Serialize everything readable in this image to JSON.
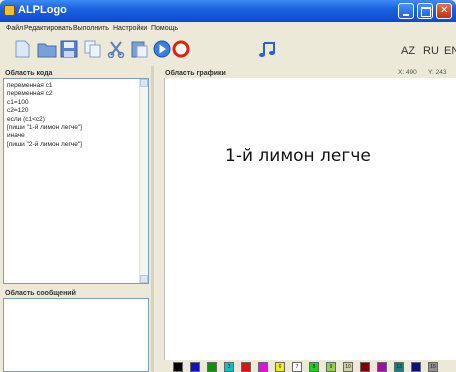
{
  "window": {
    "title": "ALPLogo"
  },
  "menu": {
    "items": [
      "Файл",
      "Редактировать",
      "Выполнить",
      "Настройки",
      "Помощь"
    ]
  },
  "toolbar": {
    "icons": [
      "new-file-icon",
      "open-folder-icon",
      "save-icon",
      "copy-icon",
      "cut-icon",
      "paste-icon",
      "run-icon",
      "stop-icon",
      "music-icon"
    ],
    "languages": [
      "AZ",
      "RU",
      "EN"
    ]
  },
  "code_panel": {
    "label": "Область кода",
    "lines": [
      "переменная c1",
      "переменная c2",
      "c1=100",
      "c2=120",
      "если (c1<c2)",
      "[пиши \"1-й лимон легче\"]",
      "иначе",
      "[пиши \"2-й лимон легче\"]"
    ]
  },
  "messages_panel": {
    "label": "Область сообщений"
  },
  "graphics_panel": {
    "label": "Область графики",
    "coord_x": "X: 490",
    "coord_y": "Y: 243",
    "output_text": "1-й лимон легче"
  },
  "palette": {
    "colors": [
      {
        "hex": "#000000",
        "label": ""
      },
      {
        "hex": "#1010c8",
        "label": ""
      },
      {
        "hex": "#109010",
        "label": ""
      },
      {
        "hex": "#10c0c0",
        "label": "3"
      },
      {
        "hex": "#e01010",
        "label": ""
      },
      {
        "hex": "#e010e0",
        "label": ""
      },
      {
        "hex": "#f0f010",
        "label": "6"
      },
      {
        "hex": "#ffffff",
        "label": "7"
      },
      {
        "hex": "#20d020",
        "label": "8"
      },
      {
        "hex": "#90d050",
        "label": "9"
      },
      {
        "hex": "#d0d0a0",
        "label": "10"
      },
      {
        "hex": "#800000",
        "label": ""
      },
      {
        "hex": "#a010a0",
        "label": ""
      },
      {
        "hex": "#108080",
        "label": "13"
      },
      {
        "hex": "#101080",
        "label": ""
      },
      {
        "hex": "#909090",
        "label": "15"
      }
    ]
  }
}
